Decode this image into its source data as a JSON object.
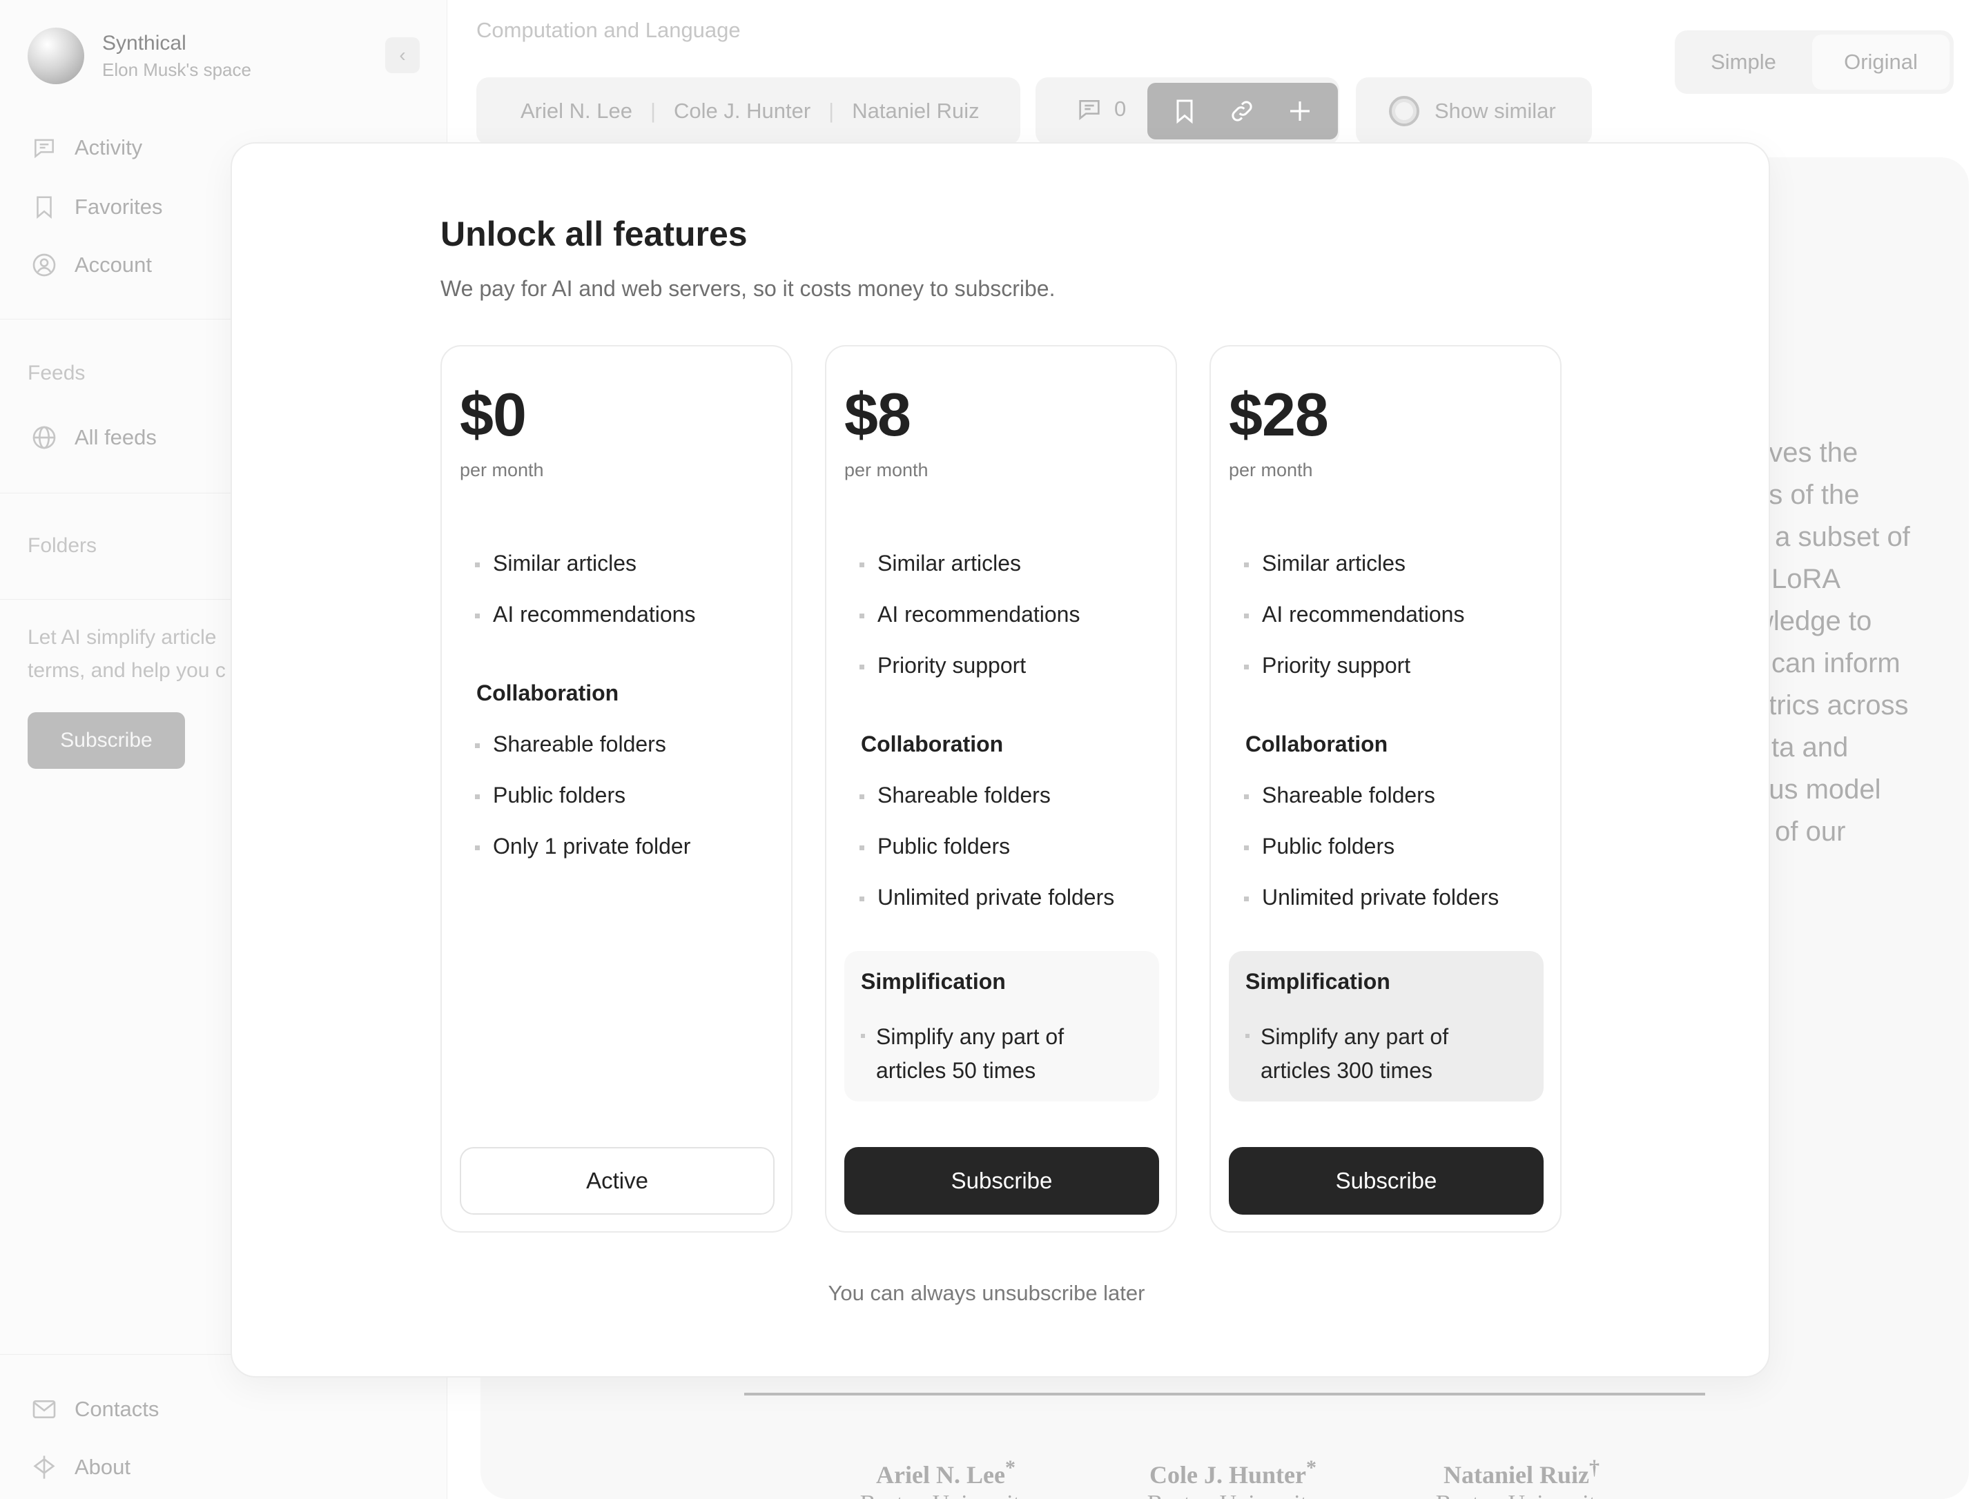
{
  "workspace": {
    "name": "Synthical",
    "subtitle": "Elon Musk's space"
  },
  "sidebar": {
    "nav": [
      {
        "label": "Activity",
        "icon": "chat-bubble-icon"
      },
      {
        "label": "Favorites",
        "icon": "bookmark-icon"
      },
      {
        "label": "Account",
        "icon": "user-circle-icon"
      }
    ],
    "feeds_label": "Feeds",
    "all_feeds": "All feeds",
    "folders_label": "Folders",
    "promo_line1": "Let AI simplify article",
    "promo_line2": "terms, and help you c",
    "subscribe": "Subscribe",
    "contacts": "Contacts",
    "about": "About"
  },
  "header": {
    "breadcrumb": "Computation and Language",
    "authors": [
      "Ariel N. Lee",
      "Cole J. Hunter",
      "Nataniel Ruiz"
    ],
    "comment_count": "0",
    "show_similar": "Show similar",
    "view_simple": "Simple",
    "view_original": "Original"
  },
  "article": {
    "abstract_fragments": [
      "eves the",
      "as of the",
      "s a subset of",
      "LoRA",
      "wledge to",
      "can inform",
      "etrics across",
      "ta and",
      "ous model",
      "y of our"
    ],
    "paper_authors": [
      {
        "name": "Ariel N. Lee",
        "mark": "*",
        "affiliation": "Boston University"
      },
      {
        "name": "Cole J. Hunter",
        "mark": "*",
        "affiliation": "Boston University"
      },
      {
        "name": "Nataniel Ruiz",
        "mark": "†",
        "affiliation": "Boston University"
      }
    ]
  },
  "modal": {
    "title": "Unlock all features",
    "subtitle": "We pay for AI and web servers, so it costs money to subscribe.",
    "footnote": "You can always unsubscribe later",
    "per_month": "per month",
    "collaboration_label": "Collaboration",
    "simplification_label": "Simplification",
    "plans": [
      {
        "price": "$0",
        "features": [
          "Similar articles",
          "AI recommendations"
        ],
        "collaboration": [
          "Shareable folders",
          "Public folders",
          "Only 1 private folder"
        ],
        "button": "Active"
      },
      {
        "price": "$8",
        "features": [
          "Similar articles",
          "AI recommendations",
          "Priority support"
        ],
        "collaboration": [
          "Shareable folders",
          "Public folders",
          "Unlimited private folders"
        ],
        "simplification": "Simplify any part of articles 50 times",
        "button": "Subscribe"
      },
      {
        "price": "$28",
        "features": [
          "Similar articles",
          "AI recommendations",
          "Priority support"
        ],
        "collaboration": [
          "Shareable folders",
          "Public folders",
          "Unlimited private folders"
        ],
        "simplification": "Simplify any part of articles 300 times",
        "button": "Subscribe"
      }
    ]
  },
  "colors": {
    "dark_button": "#262626",
    "muted_text": "#7a7a7a",
    "simplification_bg_light": "#f8f8f8",
    "simplification_bg_dark": "#ededed"
  }
}
